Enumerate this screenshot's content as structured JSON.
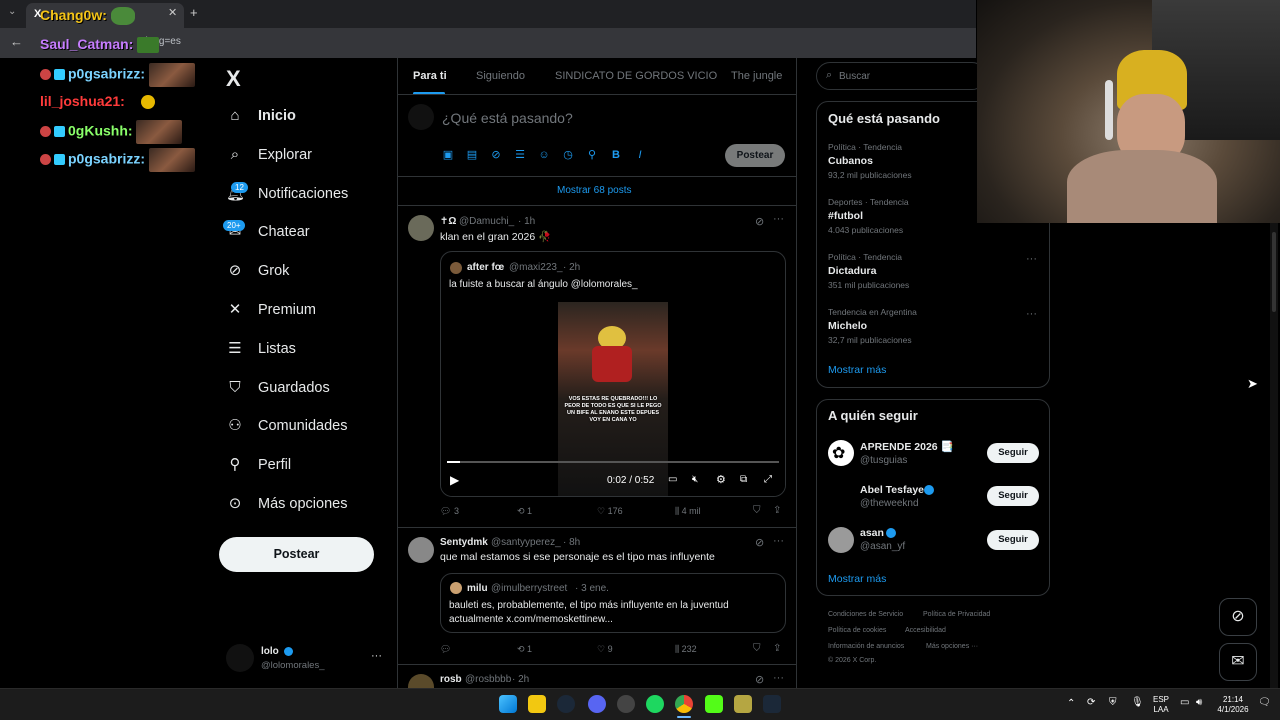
{
  "browser": {
    "tab_title": "X",
    "url_fragment": "?lang=es"
  },
  "chat": {
    "lines": [
      {
        "user": "Chang0w:",
        "color": "#f5c518"
      },
      {
        "user": "Saul_Catman:",
        "color": "#c77dff"
      },
      {
        "user": "p0gsabrizz:",
        "color": "#7bd3ff"
      },
      {
        "user": "lil_joshua21:",
        "color": "#ff3b3b"
      },
      {
        "user": "0gKushh:",
        "color": "#8aff6a"
      },
      {
        "user": "p0gsabrizz:",
        "color": "#7bd3ff"
      }
    ]
  },
  "sidebar": {
    "logo": "X",
    "items": [
      {
        "label": "Inicio",
        "icon": "home-icon"
      },
      {
        "label": "Explorar",
        "icon": "search-icon"
      },
      {
        "label": "Notificaciones",
        "icon": "bell-icon",
        "count": "12"
      },
      {
        "label": "Chatear",
        "icon": "mail-icon",
        "count": "20+"
      },
      {
        "label": "Grok",
        "icon": "grok-icon"
      },
      {
        "label": "Premium",
        "icon": "x-icon"
      },
      {
        "label": "Listas",
        "icon": "list-icon"
      },
      {
        "label": "Guardados",
        "icon": "bookmark-icon"
      },
      {
        "label": "Comunidades",
        "icon": "people-icon"
      },
      {
        "label": "Perfil",
        "icon": "person-icon"
      },
      {
        "label": "Más opciones",
        "icon": "more-circle-icon"
      }
    ],
    "post_button": "Postear",
    "account": {
      "name": "lolo",
      "handle": "@lolomorales_"
    }
  },
  "feed": {
    "tabs": [
      "Para ti",
      "Siguiendo",
      "SINDICATO DE GORDOS VICIO",
      "The jungle"
    ],
    "composer": {
      "placeholder": "¿Qué está pasando?",
      "post_button": "Postear"
    },
    "show_more": "Mostrar 68 posts",
    "posts": [
      {
        "name": "✝Ω",
        "handle": "@Damuchi_",
        "time": "· 1h",
        "text": "klan en el gran 2026 🥀",
        "quote": {
          "name": "after fœ",
          "handle": "@maxi223_",
          "time": "· 2h",
          "text": "la fuiste a buscar al ángulo @lolomorales_",
          "video_time": "0:02 / 0:52",
          "video_caption": "VOS ESTAS RE QUEBRADO!!! LO PEOR DE TODO ES QUE SI LE PEGO UN BIFE AL ENANO ESTE DEPUES VOY EN CANA YO"
        },
        "metrics": {
          "replies": "3",
          "reposts": "1",
          "likes": "176",
          "views": "4 mil"
        }
      },
      {
        "name": "Sentydmk",
        "handle": "@santyyperez_",
        "time": "· 8h",
        "text": "que mal estamos si ese personaje es el tipo mas influyente",
        "quote": {
          "name": "milu",
          "handle": "@imulberrystreet",
          "time": "· 3 ene.",
          "text": "bauleti es, probablemente, el tipo más influyente en la juventud actualmente x.com/memoskettinew..."
        },
        "metrics": {
          "replies": "",
          "reposts": "1",
          "likes": "9",
          "views": "232"
        }
      },
      {
        "name": "rosb",
        "handle": "@rosbbbb",
        "time": "· 2h"
      }
    ]
  },
  "right": {
    "search_placeholder": "Buscar",
    "trends_title": "Qué está pasando",
    "trends": [
      {
        "category": "Política · Tendencia",
        "name": "Cubanos",
        "count": "93,2 mil publicaciones"
      },
      {
        "category": "Deportes · Tendencia",
        "name": "#futbol",
        "count": "4.043 publicaciones"
      },
      {
        "category": "Política · Tendencia",
        "name": "Dictadura",
        "count": "351 mil publicaciones"
      },
      {
        "category": "Tendencia en Argentina",
        "name": "Michelo",
        "count": "32,7 mil publicaciones"
      }
    ],
    "trends_more": "Mostrar más",
    "follow_title": "A quién seguir",
    "follow": [
      {
        "name": "APRENDE 2026 📑",
        "handle": "@tusguias",
        "button": "Seguir"
      },
      {
        "name": "Abel Tesfaye",
        "handle": "@theweeknd",
        "button": "Seguir"
      },
      {
        "name": "asan",
        "handle": "@asan_yf",
        "button": "Seguir"
      }
    ],
    "follow_more": "Mostrar más",
    "footer": [
      "Condiciones de Servicio",
      "Política de Privacidad",
      "Política de cookies",
      "Accesibilidad",
      "Información de anuncios",
      "Más opciones ···",
      "© 2026 X Corp."
    ]
  },
  "taskbar": {
    "lang_top": "ESP",
    "lang_bottom": "LAA",
    "time": "21:14",
    "date": "4/1/2026"
  },
  "colors": {
    "accent": "#1d9bf0",
    "border": "#2f3336",
    "muted": "#71767b"
  }
}
